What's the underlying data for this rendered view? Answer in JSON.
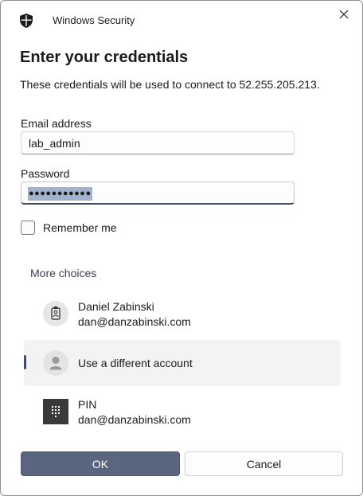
{
  "titlebar": {
    "app_title": "Windows Security",
    "close_icon": "close-icon",
    "app_icon": "shield-icon"
  },
  "heading": "Enter your credentials",
  "description": "These credentials will be used to connect to 52.255.205.213.",
  "email": {
    "label": "Email address",
    "value": "lab_admin"
  },
  "password": {
    "label": "Password",
    "masked_value": "●●●●●●●●●●●"
  },
  "remember": {
    "label": "Remember me",
    "checked": false
  },
  "more_choices": "More choices",
  "accounts": [
    {
      "name": "Daniel Zabinski",
      "email": "dan@danzabinski.com",
      "icon": "badge-icon",
      "selected": false
    },
    {
      "name": "Use a different account",
      "icon": "user-icon",
      "selected": true
    },
    {
      "name": "PIN",
      "email": "dan@danzabinski.com",
      "icon": "pin-keypad-icon",
      "selected": false
    }
  ],
  "buttons": {
    "ok": "OK",
    "cancel": "Cancel"
  },
  "colors": {
    "accent": "#5a6580",
    "selection": "#a3b2cf",
    "focus_underline": "#3f4c6b"
  }
}
